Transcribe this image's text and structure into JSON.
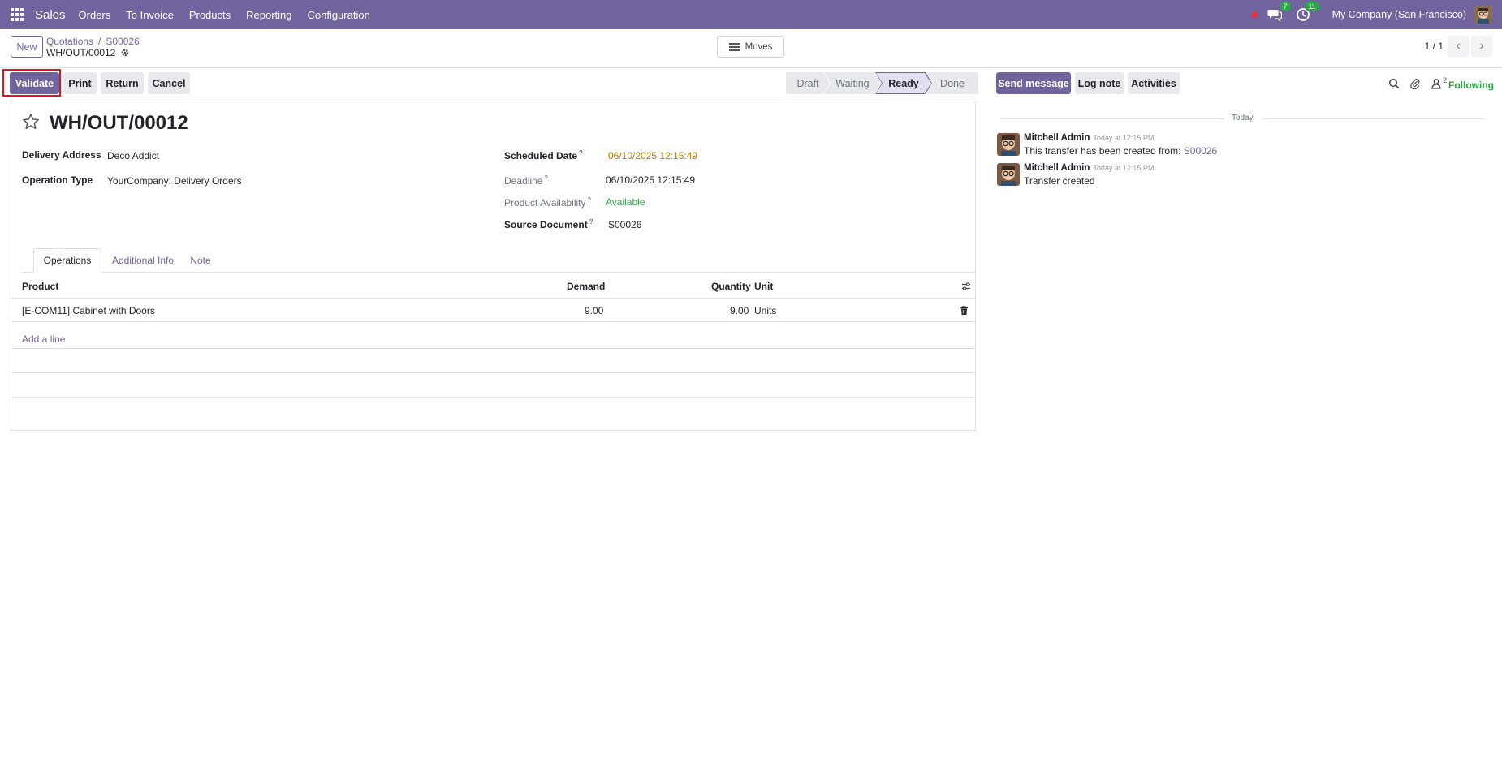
{
  "navbar": {
    "app_name": "Sales",
    "menu": [
      "Orders",
      "To Invoice",
      "Products",
      "Reporting",
      "Configuration"
    ],
    "chat_count": "7",
    "activity_count": "11",
    "company": "My Company (San Francisco)"
  },
  "control_panel": {
    "new_label": "New",
    "breadcrumb_parent": "Quotations",
    "breadcrumb_order": "S00026",
    "record_name": "WH/OUT/00012",
    "moves_label": "Moves",
    "pager": "1 / 1"
  },
  "actions": {
    "validate": "Validate",
    "print": "Print",
    "return": "Return",
    "cancel": "Cancel"
  },
  "statusbar": [
    "Draft",
    "Waiting",
    "Ready",
    "Done"
  ],
  "chatter_actions": {
    "send_message": "Send message",
    "log_note": "Log note",
    "activities": "Activities",
    "followers_count": "2",
    "following": "Following"
  },
  "form": {
    "title": "WH/OUT/00012",
    "delivery_address_label": "Delivery Address",
    "delivery_address": "Deco Addict",
    "operation_type_label": "Operation Type",
    "operation_type": "YourCompany: Delivery Orders",
    "scheduled_date_label": "Scheduled Date",
    "scheduled_date": "06/10/2025 12:15:49",
    "deadline_label": "Deadline",
    "deadline": "06/10/2025 12:15:49",
    "availability_label": "Product Availability",
    "availability": "Available",
    "source_label": "Source Document",
    "source": "S00026",
    "help_mark": "?"
  },
  "tabs": [
    "Operations",
    "Additional Info",
    "Note"
  ],
  "operations": {
    "headers": {
      "product": "Product",
      "demand": "Demand",
      "quantity": "Quantity",
      "unit": "Unit"
    },
    "rows": [
      {
        "product": "[E-COM11] Cabinet with Doors",
        "demand": "9.00",
        "quantity": "9.00",
        "unit": "Units"
      }
    ],
    "add_line": "Add a line"
  },
  "chatter": {
    "date_separator": "Today",
    "messages": [
      {
        "author": "Mitchell Admin",
        "time": "Today at 12:15 PM",
        "text": "This transfer has been created from:",
        "link": "S00026"
      },
      {
        "author": "Mitchell Admin",
        "time": "Today at 12:15 PM",
        "text": "Transfer created",
        "link": ""
      }
    ]
  },
  "colors": {
    "brand": "#71639e",
    "highlight": "#e5141b",
    "available": "#28a745",
    "warning": "#b57a00"
  }
}
